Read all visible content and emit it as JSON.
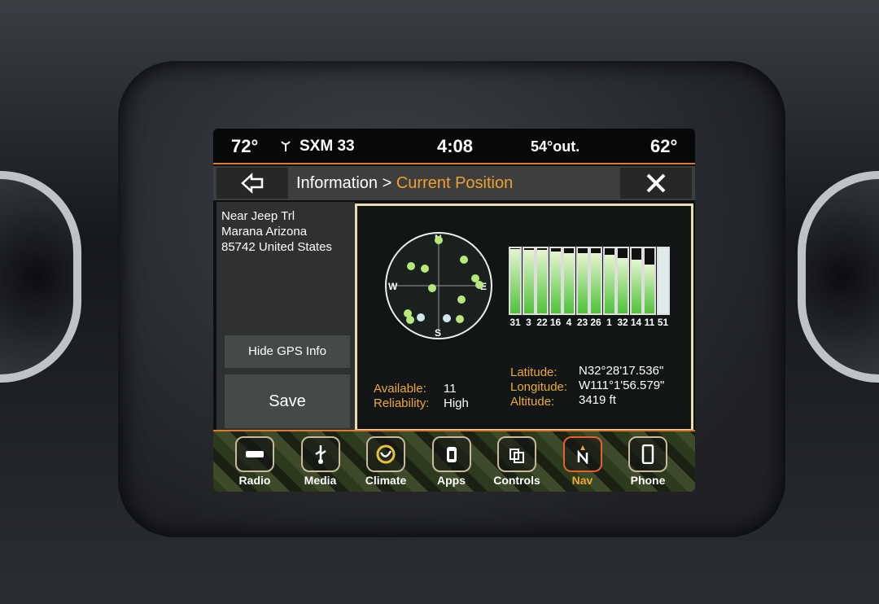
{
  "status": {
    "inside_temp_left": "72°",
    "radio": "SXM 33",
    "clock": "4:08",
    "outside_temp": "54°out.",
    "inside_temp_right": "62°"
  },
  "header": {
    "crumb_parent": "Information > ",
    "crumb_current": "Current Position",
    "back_icon": "arrow-left-icon",
    "close_icon": "close-icon"
  },
  "address": {
    "line1": "Near Jeep Trl",
    "line2": "Marana Arizona",
    "line3": "85742 United States"
  },
  "buttons": {
    "hide_gps": "Hide GPS Info",
    "save": "Save"
  },
  "compass": {
    "n": "N",
    "s": "S",
    "e": "E",
    "w": "W"
  },
  "satellites": [
    {
      "id": "31",
      "signal": 0.99
    },
    {
      "id": "3",
      "signal": 0.97
    },
    {
      "id": "22",
      "signal": 0.97
    },
    {
      "id": "16",
      "signal": 0.95
    },
    {
      "id": "4",
      "signal": 0.92
    },
    {
      "id": "23",
      "signal": 0.92
    },
    {
      "id": "26",
      "signal": 0.92
    },
    {
      "id": "1",
      "signal": 0.9
    },
    {
      "id": "32",
      "signal": 0.85
    },
    {
      "id": "14",
      "signal": 0.82
    },
    {
      "id": "11",
      "signal": 0.75
    },
    {
      "id": "51",
      "signal": 1.0,
      "unused": true
    }
  ],
  "gps": {
    "available_label": "Available:",
    "available": "11",
    "reliability_label": "Reliability:",
    "reliability": "High",
    "latitude_label": "Latitude:",
    "latitude": "N32°28'17.536\"",
    "longitude_label": "Longitude:",
    "longitude": "W111°1'56.579\"",
    "altitude_label": "Altitude:",
    "altitude": "3419 ft"
  },
  "colors": {
    "accent": "#f0a830",
    "signal": "#4fc23a",
    "active_dock": "#e8602a"
  },
  "dock": [
    {
      "label": "Radio",
      "icon": "sxm-icon"
    },
    {
      "label": "Media",
      "icon": "usb-icon"
    },
    {
      "label": "Climate",
      "icon": "climate-icon"
    },
    {
      "label": "Apps",
      "icon": "apps-icon"
    },
    {
      "label": "Controls",
      "icon": "controls-icon"
    },
    {
      "label": "Nav",
      "icon": "compass-north-icon",
      "active": true
    },
    {
      "label": "Phone",
      "icon": "phone-icon"
    }
  ]
}
